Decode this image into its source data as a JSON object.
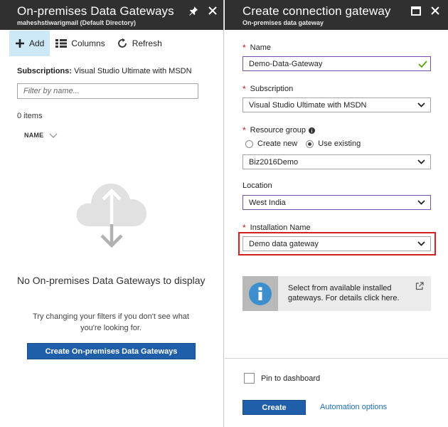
{
  "left_blade": {
    "title": "On-premises Data Gateways",
    "subtitle": "maheshstiwarigmail (Default Directory)",
    "toolbar": {
      "add_label": "Add",
      "columns_label": "Columns",
      "refresh_label": "Refresh"
    },
    "subscriptions_label": "Subscriptions:",
    "subscriptions_value": "Visual Studio Ultimate with MSDN",
    "filter_placeholder": "Filter by name...",
    "items_count": "0 items",
    "column_name": "NAME",
    "empty_title": "No On-premises Data Gateways to display",
    "empty_hint": "Try changing your filters if you don't see what you're looking for.",
    "create_button": "Create On-premises Data Gateways"
  },
  "right_blade": {
    "title": "Create connection gateway",
    "subtitle": "On-premises data gateway",
    "name_label": "Name",
    "name_value": "Demo-Data-Gateway",
    "subscription_label": "Subscription",
    "subscription_value": "Visual Studio Ultimate with MSDN",
    "resource_group_label": "Resource group",
    "radio_create_new": "Create new",
    "radio_use_existing": "Use existing",
    "resource_group_value": "Biz2016Demo",
    "location_label": "Location",
    "location_value": "West India",
    "installation_label": "Installation Name",
    "installation_value": "Demo data gateway",
    "info_text": "Select from available installed gateways. For details click here.",
    "pin_label": "Pin to dashboard",
    "create_button": "Create",
    "automation_link": "Automation options"
  },
  "colors": {
    "header_bg": "#303030",
    "accent_blue": "#1f5ea8",
    "focus_purple": "#7a4fb5",
    "highlight_red": "#d62020",
    "required_red": "#c6131b",
    "check_green": "#57a300",
    "toolbar_active": "#cde8f6"
  }
}
